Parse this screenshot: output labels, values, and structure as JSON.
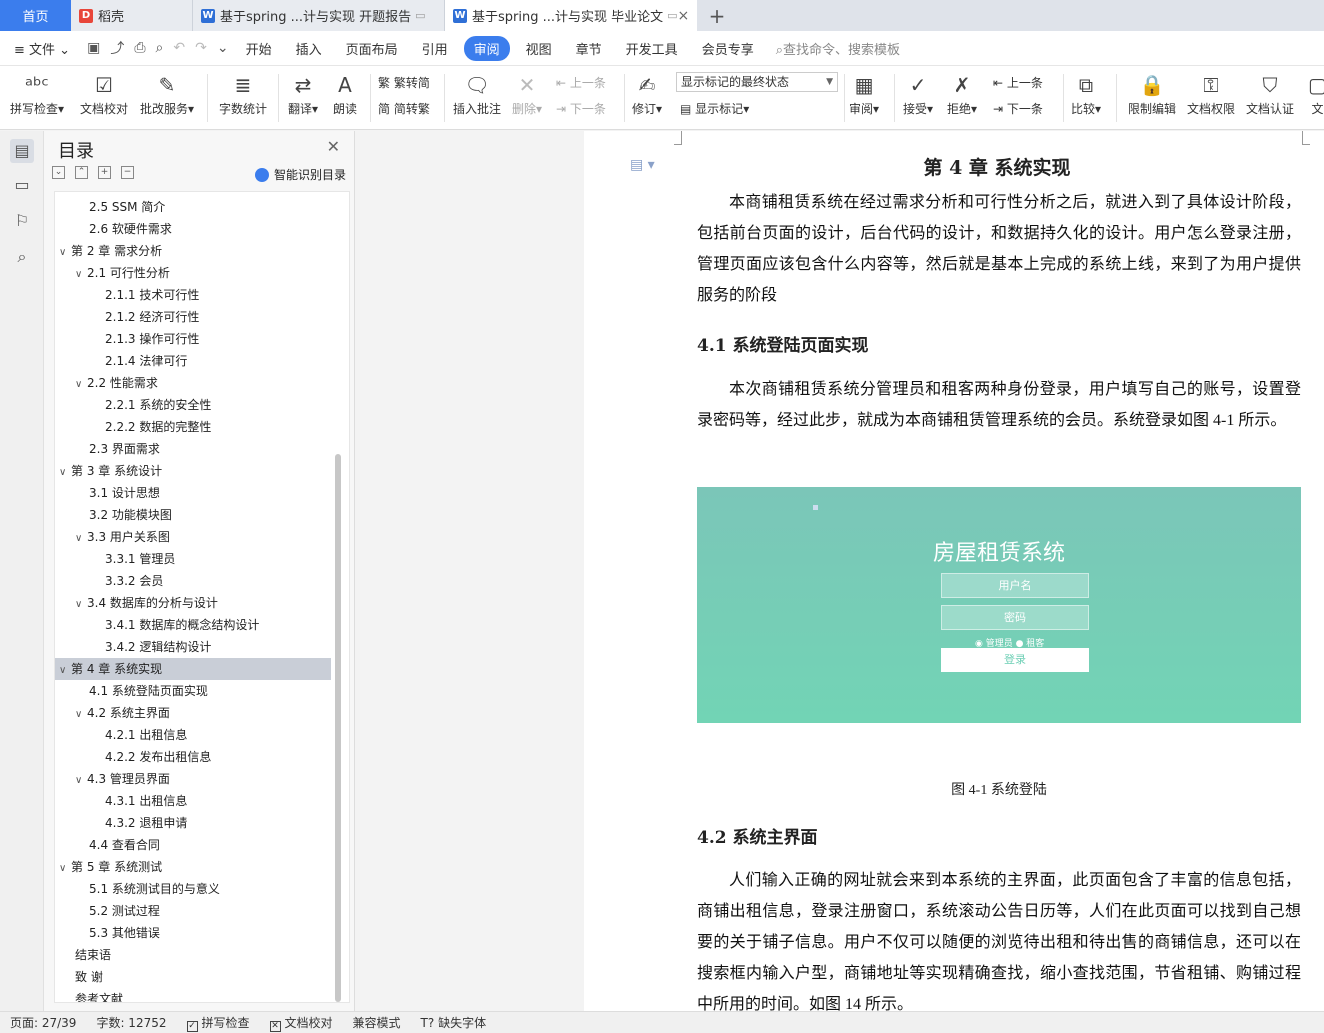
{
  "tabs": [
    {
      "label": "首页"
    },
    {
      "label": "稻壳"
    },
    {
      "label": "基于spring ...计与实现 开题报告"
    },
    {
      "label": "基于spring ...计与实现 毕业论文"
    }
  ],
  "menu": {
    "file": "文件",
    "items": [
      "开始",
      "插入",
      "页面布局",
      "引用",
      "审阅",
      "视图",
      "章节",
      "开发工具",
      "会员专享"
    ],
    "search": "查找命令、搜索模板"
  },
  "ribbon": {
    "spell": "拼写检查",
    "proofread": "文档校对",
    "review_service": "批改服务",
    "word_count": "字数统计",
    "translate": "翻译",
    "read": "朗读",
    "trad": "繁转简",
    "simp": "简转繁",
    "insert_comment": "插入批注",
    "delete": "删除",
    "prev": "上一条",
    "next": "下一条",
    "revise": "修订",
    "markup_state": "显示标记的最终状态",
    "show_markup": "显示标记",
    "review": "审阅",
    "accept": "接受",
    "reject": "拒绝",
    "prev2": "上一条",
    "next2": "下一条",
    "compare": "比较",
    "restrict": "限制编辑",
    "permission": "文档权限",
    "certify": "文档认证",
    "doc_more": "文"
  },
  "toc": {
    "title": "目录",
    "smart": "智能识别目录",
    "items": [
      {
        "text": "2.5 SSM 简介",
        "level": 2,
        "toggle": ""
      },
      {
        "text": "2.6 软硬件需求",
        "level": 2,
        "toggle": ""
      },
      {
        "text": "第 2 章  需求分析",
        "level": 1,
        "toggle": "v"
      },
      {
        "text": "2.1  可行性分析",
        "level": 2,
        "toggle": "v"
      },
      {
        "text": "2.1.1  技术可行性",
        "level": 3,
        "toggle": ""
      },
      {
        "text": "2.1.2  经济可行性",
        "level": 3,
        "toggle": ""
      },
      {
        "text": "2.1.3  操作可行性",
        "level": 3,
        "toggle": ""
      },
      {
        "text": "2.1.4  法律可行",
        "level": 3,
        "toggle": ""
      },
      {
        "text": "2.2 性能需求",
        "level": 2,
        "toggle": "v"
      },
      {
        "text": "2.2.1 系统的安全性",
        "level": 3,
        "toggle": ""
      },
      {
        "text": "2.2.2 数据的完整性",
        "level": 3,
        "toggle": ""
      },
      {
        "text": "2.3 界面需求",
        "level": 2,
        "toggle": ""
      },
      {
        "text": "第 3 章  系统设计",
        "level": 1,
        "toggle": "v"
      },
      {
        "text": "3.1 设计思想",
        "level": 2,
        "toggle": ""
      },
      {
        "text": "3.2 功能模块图",
        "level": 2,
        "toggle": ""
      },
      {
        "text": "3.3 用户关系图",
        "level": 2,
        "toggle": "v"
      },
      {
        "text": "3.3.1 管理员",
        "level": 3,
        "toggle": ""
      },
      {
        "text": "3.3.2 会员",
        "level": 3,
        "toggle": ""
      },
      {
        "text": "3.4 数据库的分析与设计",
        "level": 2,
        "toggle": "v"
      },
      {
        "text": "3.4.1 数据库的概念结构设计",
        "level": 3,
        "toggle": ""
      },
      {
        "text": "3.4.2 逻辑结构设计",
        "level": 3,
        "toggle": ""
      },
      {
        "text": "第 4 章  系统实现",
        "level": 1,
        "toggle": "v",
        "selected": true
      },
      {
        "text": "4.1  系统登陆页面实现",
        "level": 2,
        "toggle": ""
      },
      {
        "text": "4.2  系统主界面",
        "level": 2,
        "toggle": "v"
      },
      {
        "text": "4.2.1  出租信息",
        "level": 3,
        "toggle": ""
      },
      {
        "text": "4.2.2  发布出租信息",
        "level": 3,
        "toggle": ""
      },
      {
        "text": "4.3  管理员界面",
        "level": 2,
        "toggle": "v"
      },
      {
        "text": "4.3.1  出租信息",
        "level": 3,
        "toggle": ""
      },
      {
        "text": "4.3.2  退租申请",
        "level": 3,
        "toggle": ""
      },
      {
        "text": "4.4  查看合同",
        "level": 2,
        "toggle": ""
      },
      {
        "text": "第 5 章  系统测试",
        "level": 1,
        "toggle": "v"
      },
      {
        "text": "5.1  系统测试目的与意义",
        "level": 2,
        "toggle": ""
      },
      {
        "text": "5.2  测试过程",
        "level": 2,
        "toggle": ""
      },
      {
        "text": "5.3  其他错误",
        "level": 2,
        "toggle": ""
      },
      {
        "text": "结束语",
        "level": 1,
        "toggle": ""
      },
      {
        "text": "致    谢",
        "level": 1,
        "toggle": ""
      },
      {
        "text": "参考文献",
        "level": 1,
        "toggle": ""
      }
    ]
  },
  "document": {
    "chapter_title": "第 4 章  系统实现",
    "para1": "本商铺租赁系统在经过需求分析和可行性分析之后，就进入到了具体设计阶段，包括前台页面的设计，后台代码的设计，和数据持久化的设计。用户怎么登录注册，管理页面应该包含什么内容等，然后就是基本上完成的系统上线，来到了为用户提供服务的阶段",
    "h41": "4.1  系统登陆页面实现",
    "para2": "本次商铺租赁系统分管理员和租客两种身份登录，用户填写自己的账号，设置登录密码等，经过此步，就成为本商铺租赁管理系统的会员。系统登录如图 4-1 所示。",
    "shot": {
      "title": "房屋租赁系统",
      "username": "用户名",
      "password": "密码",
      "radio": "◉ 管理员  ● 租客",
      "login": "登录"
    },
    "caption": "图 4-1 系统登陆",
    "h42": "4.2  系统主界面",
    "para3": "人们输入正确的网址就会来到本系统的主界面，此页面包含了丰富的信息包括，商铺出租信息，登录注册窗口，系统滚动公告日历等，人们在此页面可以找到自己想要的关于铺子信息。用户不仅可以随便的浏览待出租和待出售的商铺信息，还可以在搜索框内输入户型，商铺地址等实现精确查找，缩小查找范围，节省租铺、购铺过程中所用的时间。如图 14 所示。"
  },
  "status": {
    "page": "页面: 27/39",
    "words": "字数: 12752",
    "spell": "拼写检查",
    "proof": "文档校对",
    "compat": "兼容模式",
    "missing_font": "缺失字体"
  },
  "colors": {
    "accent": "#3b7ded",
    "login_bg": "#72d4b5"
  }
}
